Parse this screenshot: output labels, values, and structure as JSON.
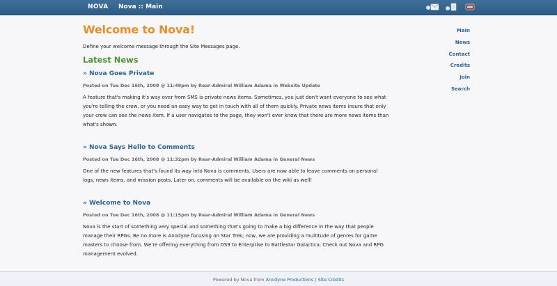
{
  "topbar": {
    "brand": "NOVA",
    "breadcrumb": "Nova :: Main",
    "icons": [
      "mail-icon",
      "document-icon",
      "login-icon"
    ]
  },
  "main": {
    "title": "Welcome to Nova!",
    "welcome_message": "Define your welcome message through the Site Messages page.",
    "latest_heading": "Latest News",
    "news": [
      {
        "title": "» Nova Goes Private",
        "meta": "Posted on Tue Dec 16th, 2008 @ 11:49pm by Rear-Admiral William Adama in Website Update",
        "body": "A feature that's making it's way over from SMS is private news items. Sometimes, you just don't want everyone to see what you're telling the crew, or you need an easy way to get in touch with all of them quickly. Private news items insure that only your crew can see the news item. If a user navigates to the page, they won't ever know that there are more news items than what's shown."
      },
      {
        "title": "» Nova Says Hello to Comments",
        "meta": "Posted on Tue Dec 16th, 2008 @ 11:32pm by Rear-Admiral William Adama in General News",
        "body": "One of the new features that's found its way into Nova is comments. Users are now able to leave comments on personal logs, news items, and mission posts. Later on, comments will be available on the wiki as well!"
      },
      {
        "title": "» Welcome to Nova",
        "meta": "Posted on Tue Dec 16th, 2008 @ 11:15pm by Rear-Admiral William Adama in General News",
        "body": "Nova is the start of something very special and something that's going to make a big difference in the way that people manage their RPGs. Be no more is Anodyne focusing on Star Trek; now, we are providing a multitude of genres for game masters to choose from. We're offering everything from DS9 to Enterprise to Battlestar Galactica. Check out Nova and RPG management evolved."
      }
    ]
  },
  "sidebar": {
    "items": [
      "Main",
      "News",
      "Contact",
      "Credits",
      "Join",
      "Search"
    ]
  },
  "footer": {
    "prefix": "Powered by Nova from",
    "company": "Anodyne Productions",
    "separator": "|",
    "credits": "Site Credits"
  },
  "colors": {
    "topbar": "#2e5c85",
    "title": "#e4902a",
    "heading": "#4f8f32",
    "link": "#2e6392"
  }
}
